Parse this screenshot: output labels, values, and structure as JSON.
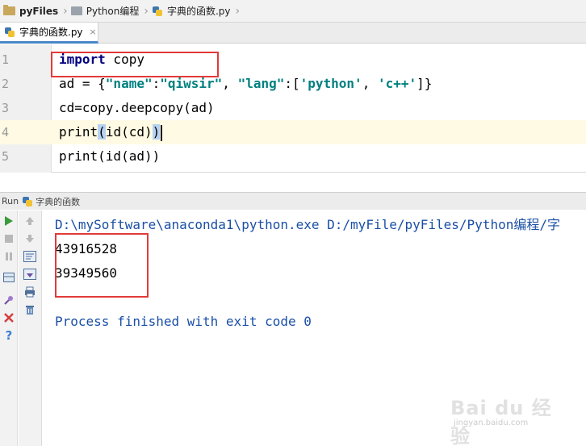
{
  "breadcrumb": {
    "items": [
      {
        "label": "pyFiles",
        "icon": "folder-icon"
      },
      {
        "label": "Python编程",
        "icon": "folder-icon"
      },
      {
        "label": "字典的函数.py",
        "icon": "python-file-icon"
      }
    ]
  },
  "editor_tab": {
    "label": "字典的函数.py",
    "close": "×"
  },
  "editor": {
    "line_numbers": [
      "1",
      "2",
      "3",
      "4",
      "5"
    ],
    "lines": {
      "l1_kw": "import",
      "l1_rest": " copy",
      "l2_a": "ad = {",
      "l2_s1": "\"name\"",
      "l2_b": ":",
      "l2_s2": "\"qiwsir\"",
      "l2_c": ", ",
      "l2_s3": "\"lang\"",
      "l2_d": ":[",
      "l2_s4": "'python'",
      "l2_e": ", ",
      "l2_s5": "'c++'",
      "l2_f": "]}",
      "l3": "cd=copy.deepcopy(ad)",
      "l4_a": "print",
      "l4_p1": "(",
      "l4_b": "id(cd)",
      "l4_p2": ")",
      "l5": "print(id(ad))"
    }
  },
  "run_panel": {
    "title": "Run",
    "config_name": "字典的函数",
    "console": {
      "command": "D:\\mySoftware\\anaconda1\\python.exe D:/myFile/pyFiles/Python编程/字",
      "output1": "43916528",
      "output2": "39349560",
      "exit_message": "Process finished with exit code 0"
    }
  },
  "watermark": {
    "text": "Bai du 经验",
    "sub": "jingyan.baidu.com"
  },
  "colors": {
    "highlight_box": "#e23a3a",
    "keyword": "#000080",
    "string": "#008080",
    "console_text": "#1a4fa6",
    "run_green": "#3c9a3c",
    "stop_red": "#d43c3c"
  }
}
